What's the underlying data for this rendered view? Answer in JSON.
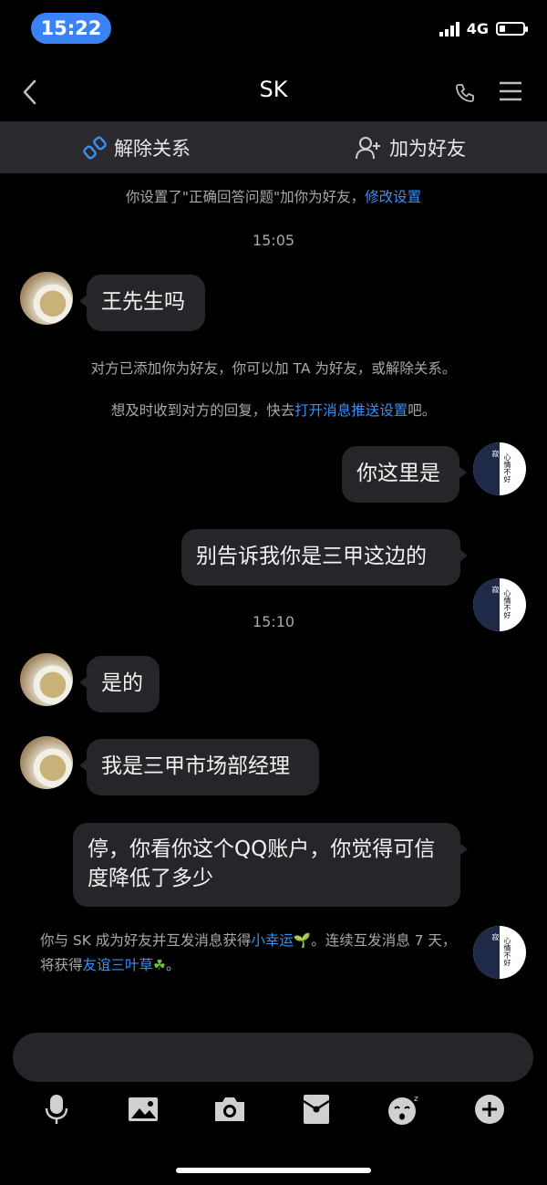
{
  "status_bar": {
    "time": "15:22",
    "network": "4G"
  },
  "nav": {
    "title": "SK"
  },
  "actions": {
    "unlink": "解除关系",
    "add_friend": "加为好友"
  },
  "system": {
    "setting_prefix": "你设置了\"正确回答问题\"加你为好友，",
    "setting_link": "修改设置",
    "added_notice": "对方已添加你为好友，你可以加 TA 为好友，或解除关系。",
    "push_prefix": "想及时收到对方的回复，快去",
    "push_link": "打开消息推送设置",
    "push_suffix": "吧。"
  },
  "timestamps": [
    "15:05",
    "15:10"
  ],
  "messages": [
    {
      "side": "left",
      "text": "王先生吗"
    },
    {
      "side": "right",
      "text": "你这里是"
    },
    {
      "side": "right",
      "text": "别告诉我你是三甲这边的"
    },
    {
      "side": "left",
      "text": "是的"
    },
    {
      "side": "left",
      "text": "我是三甲市场部经理"
    },
    {
      "side": "right",
      "text": "停，你看你这个QQ账户，你觉得可信度降低了多少"
    }
  ],
  "friend_note": {
    "line1_prefix": "你与 SK 成为好友并互发消息获得",
    "link1": "小幸运",
    "line1_suffix": "。连续互发消息 7 天，",
    "line2_prefix": "将获得",
    "link2": "友谊三叶草",
    "line2_suffix": "。"
  },
  "my_avatar_text": {
    "left": "寂",
    "right": "心情不好"
  },
  "icons": [
    "back-icon",
    "phone-icon",
    "menu-icon",
    "unlink-icon",
    "add-friend-icon",
    "mic-icon",
    "image-icon",
    "camera-icon",
    "red-packet-icon",
    "emoji-icon",
    "plus-icon"
  ],
  "colors": {
    "accent": "#3b82f6",
    "link": "#3a8ff7",
    "bubble": "#26262a",
    "bar": "#2a2a2e"
  }
}
